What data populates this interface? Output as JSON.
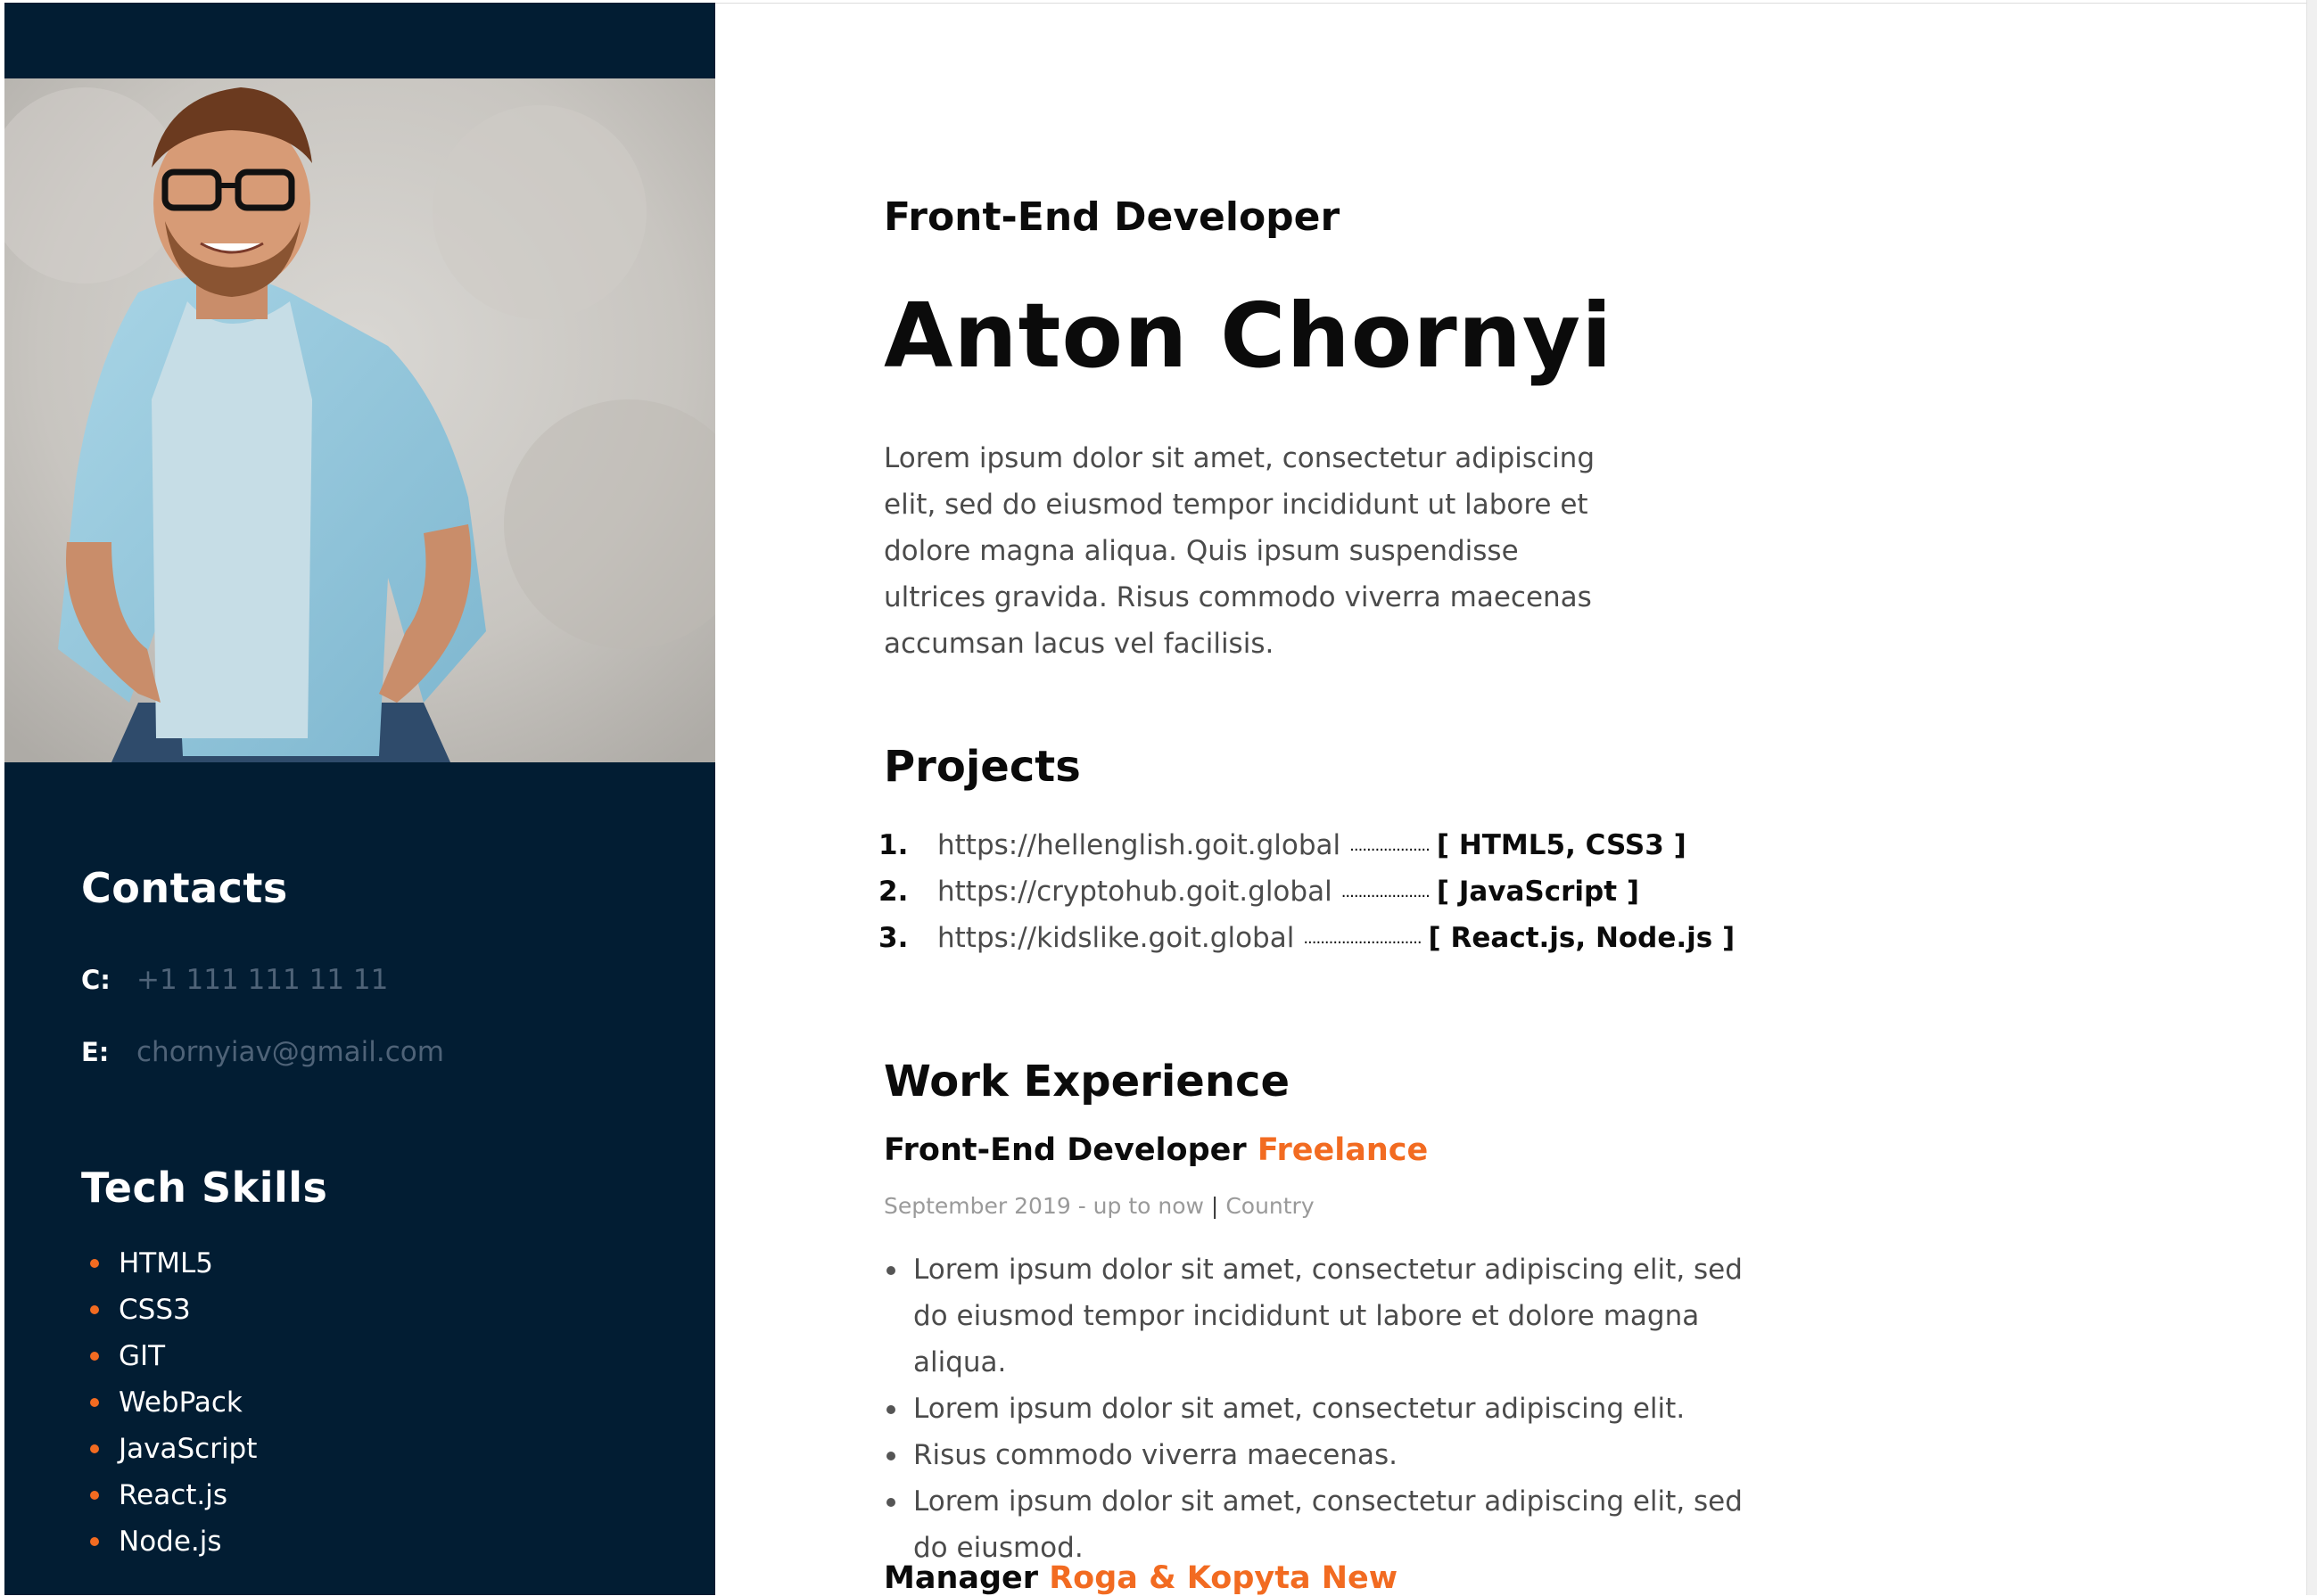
{
  "colors": {
    "sidebar_bg": "#021d33",
    "accent": "#f26b21",
    "heading_text": "#0b0b0b",
    "body_text": "#4b4b4b",
    "muted_text": "#9a9a9a"
  },
  "sidebar": {
    "photo_alt": "profile-photo",
    "contacts": {
      "heading": "Contacts",
      "phone_key": "C:",
      "phone_value": "+1 111 111 11 11",
      "email_key": "E:",
      "email_value": "chornyiav@gmail.com"
    },
    "skills": {
      "heading": "Tech Skills",
      "items": [
        "HTML5",
        "CSS3",
        "GIT",
        "WebPack",
        "JavaScript",
        "React.js",
        "Node.js"
      ]
    }
  },
  "main": {
    "role": "Front-End Developer",
    "name": "Anton Chornyi",
    "intro": "Lorem ipsum dolor sit amet, consectetur adipiscing elit, sed do eiusmod tempor incididunt ut labore et dolore magna aliqua. Quis ipsum suspendisse ultrices gravida. Risus commodo viverra maecenas accumsan lacus vel facilisis.",
    "projects": {
      "heading": "Projects",
      "items": [
        {
          "num": "1.",
          "url": "https://hellenglish.goit.global",
          "dots": "...................",
          "tech": "[ HTML5, CSS3 ]"
        },
        {
          "num": "2.",
          "url": "https://cryptohub.goit.global",
          "dots": ".....................",
          "tech": "[ JavaScript ]"
        },
        {
          "num": "3.",
          "url": "https://kidslike.goit.global",
          "dots": "............................",
          "tech": "[ React.js, Node.js ]"
        }
      ]
    },
    "experience": {
      "heading": "Work Experience",
      "jobs": [
        {
          "title": "Front-End Developer",
          "company": "Freelance",
          "period": "September 2019 - up to now",
          "separator": "|",
          "location": "Country",
          "duties": [
            "Lorem ipsum dolor sit amet, consectetur adipiscing elit, sed do eiusmod tempor incididunt ut labore et dolore magna aliqua.",
            "Lorem ipsum dolor sit amet, consectetur adipiscing elit.",
            "Risus commodo viverra maecenas.",
            "Lorem ipsum dolor sit amet, consectetur adipiscing elit, sed do eiusmod."
          ]
        },
        {
          "title": "Manager",
          "company": "Roga & Kopyta New"
        }
      ]
    }
  }
}
